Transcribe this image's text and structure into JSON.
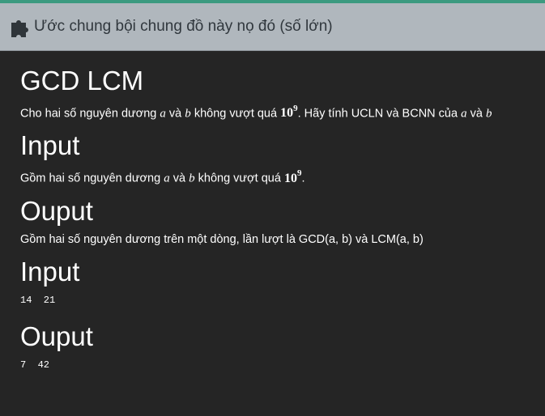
{
  "header": {
    "title": "Ước chung bội chung đồ này nọ đó (số lớn)",
    "icon": "puzzle-icon"
  },
  "problem": {
    "heading": "GCD LCM",
    "statement_prefix": "Cho hai số nguyên dương",
    "var_a": "a",
    "word_and": "và",
    "var_b": "b",
    "limit_phrase": "không vượt quá",
    "limit_base": "10",
    "limit_exp": "9",
    "statement_suffix": ". Hãy tính UCLN và BCNN của",
    "var_a2": "a",
    "word_and2": "và",
    "var_b2": "b"
  },
  "input_section": {
    "heading": "Input",
    "prefix": "Gồm hai số nguyên dương",
    "var_a": "a",
    "word_and": "và",
    "var_b": "b",
    "limit_phrase": "không vượt quá",
    "limit_base": "10",
    "limit_exp": "9",
    "suffix": "."
  },
  "output_section": {
    "heading": "Ouput",
    "text": "Gồm hai số nguyên dương trên một dòng, lần lượt là GCD(a, b) và LCM(a, b)"
  },
  "sample_input": {
    "heading": "Input",
    "value": "14  21"
  },
  "sample_output": {
    "heading": "Ouput",
    "value": "7  42"
  }
}
